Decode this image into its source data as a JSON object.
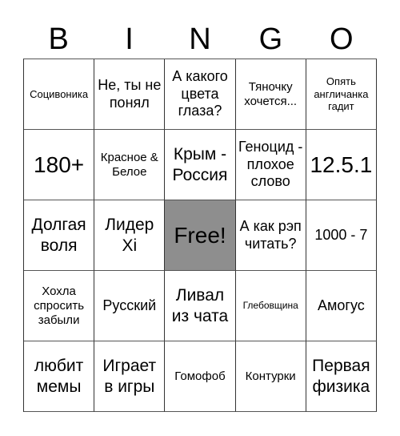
{
  "header": {
    "letters": [
      "B",
      "I",
      "N",
      "G",
      "O"
    ]
  },
  "colors": {
    "free_cell": "#8e8e8e",
    "border": "#333333",
    "background": "#ffffff"
  },
  "cells": [
    [
      "Социвоника",
      "Не, ты не понял",
      "А какого цвета глаза?",
      "Тяночку хочется...",
      "Опять англичанка гадит"
    ],
    [
      "180+",
      "Красное & Белое",
      "Крым - Россия",
      "Геноцид - плохое слово",
      "12.5.1"
    ],
    [
      "Долгая воля",
      "Лидер Xi",
      "Free!",
      "А как рэп читать?",
      "1000 - 7"
    ],
    [
      "Хохла спросить забыли",
      "Русский",
      "Ливал из чата",
      "Глебовщина",
      "Амогус"
    ],
    [
      "любит мемы",
      "Играет в игры",
      "Гомофоб",
      "Контурки",
      "Первая физика"
    ]
  ]
}
